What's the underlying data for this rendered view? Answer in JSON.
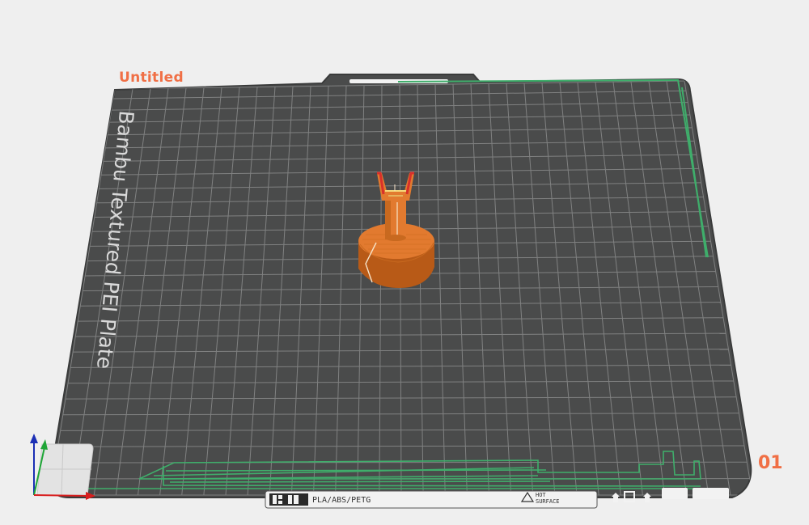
{
  "app": {
    "plate_title": "Untitled",
    "plate_index": "01"
  },
  "build_plate": {
    "name": "Bambu Textured PEI Plate",
    "surface_color": "#4a4b4b",
    "grid_color": "#8a8b8b",
    "bottom_strip": {
      "materials": "PLA/ABS/PETG",
      "warning_line1": "HOT",
      "warning_line2": "SURFACE"
    }
  },
  "model": {
    "color": "#e27a2f",
    "shadow_color": "#b85a17"
  },
  "colors": {
    "accent": "#f06f45",
    "purge_line": "#3fae6b",
    "axis_x": "#d81e1e",
    "axis_y": "#1fa637",
    "axis_z": "#1b2fb5"
  },
  "icons": [
    "bambu-logo-icon",
    "warning-triangle-icon",
    "upload-icon",
    "square-icon",
    "axis-gizmo-icon"
  ]
}
